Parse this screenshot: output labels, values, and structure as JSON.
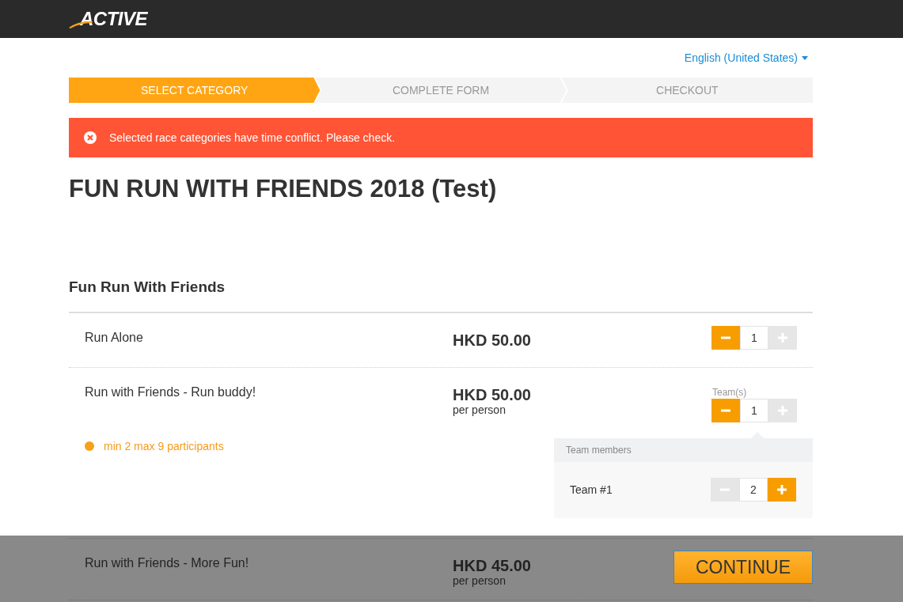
{
  "header": {
    "logo": "ACTIVE"
  },
  "language": "English (United States)",
  "steps": [
    {
      "label": "SELECT CATEGORY",
      "selected": true
    },
    {
      "label": "COMPLETE FORM",
      "selected": false
    },
    {
      "label": "CHECKOUT",
      "selected": false
    }
  ],
  "alert": {
    "message": "Selected race categories have time conflict. Please check."
  },
  "event_title": "FUN RUN WITH FRIENDS 2018 (Test)",
  "section_title": "Fun Run With Friends",
  "categories": [
    {
      "name": "Run Alone",
      "price": "HKD 50.00",
      "stepper": {
        "value": "1",
        "minus_disabled": false,
        "plus_disabled": true
      }
    },
    {
      "name": "Run with Friends - Run buddy!",
      "price": "HKD 50.00",
      "price_note": "per person",
      "note": "min 2 max 9 participants",
      "stepper_label": "Team(s)",
      "stepper": {
        "value": "1",
        "minus_disabled": false,
        "plus_disabled": true
      },
      "team_panel": {
        "heading": "Team members",
        "teams": [
          {
            "name": "Team #1",
            "stepper": {
              "value": "2",
              "minus_disabled": true,
              "plus_disabled": false
            }
          }
        ]
      }
    },
    {
      "name": "Run with Friends - More Fun!",
      "price": "HKD 45.00",
      "price_note": "per person"
    }
  ],
  "footer": {
    "button": "CONTINUE"
  }
}
